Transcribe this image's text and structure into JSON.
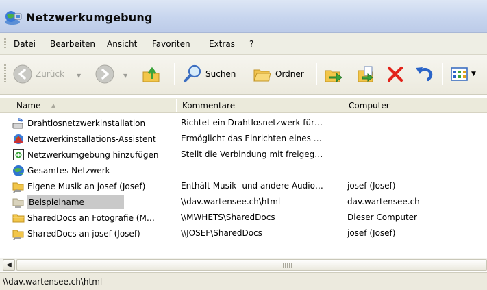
{
  "window": {
    "title": "Netzwerkumgebung"
  },
  "menu": {
    "items": [
      {
        "label": "Datei"
      },
      {
        "label": "Bearbeiten"
      },
      {
        "label": "Ansicht"
      },
      {
        "label": "Favoriten"
      },
      {
        "label": "Extras"
      },
      {
        "label": "?"
      }
    ]
  },
  "toolbar": {
    "back_label": "Zurück",
    "search_label": "Suchen",
    "folders_label": "Ordner"
  },
  "columns": {
    "name": "Name",
    "comment": "Kommentare",
    "computer": "Computer"
  },
  "rows": [
    {
      "name": "Drahtlosnetzwerkinstallation",
      "comment": "Richtet ein Drahtlosnetzwerk für…",
      "computer": "",
      "icon": "wireless-setup-icon"
    },
    {
      "name": "Netzwerkinstallations-Assistent",
      "comment": "Ermöglicht das Einrichten eines …",
      "computer": "",
      "icon": "network-wizard-icon"
    },
    {
      "name": "Netzwerkumgebung hinzufügen",
      "comment": "Stellt die Verbindung mit freigeg…",
      "computer": "",
      "icon": "add-network-place-icon"
    },
    {
      "name": "Gesamtes Netzwerk",
      "comment": "",
      "computer": "",
      "icon": "globe-icon"
    },
    {
      "name": "Eigene Musik an josef (Josef)",
      "comment": "Enthält Musik- und andere Audio…",
      "computer": "josef (Josef)",
      "icon": "network-folder-icon"
    },
    {
      "name": "Beispielname",
      "comment": "\\\\dav.wartensee.ch\\html",
      "computer": "dav.wartensee.ch",
      "icon": "network-folder-icon",
      "selected": true
    },
    {
      "name": "SharedDocs an Fotografie (M…",
      "comment": "\\\\MWHETS\\SharedDocs",
      "computer": "Dieser Computer",
      "icon": "folder-icon"
    },
    {
      "name": "SharedDocs an josef (Josef)",
      "comment": "\\\\JOSEF\\SharedDocs",
      "computer": "josef (Josef)",
      "icon": "network-folder-icon"
    }
  ],
  "status": {
    "text": "\\\\dav.wartensee.ch\\html"
  },
  "colors": {
    "selection": "#c9c9c9",
    "delete_red": "#e2231a",
    "accent_blue": "#2a64c8"
  }
}
